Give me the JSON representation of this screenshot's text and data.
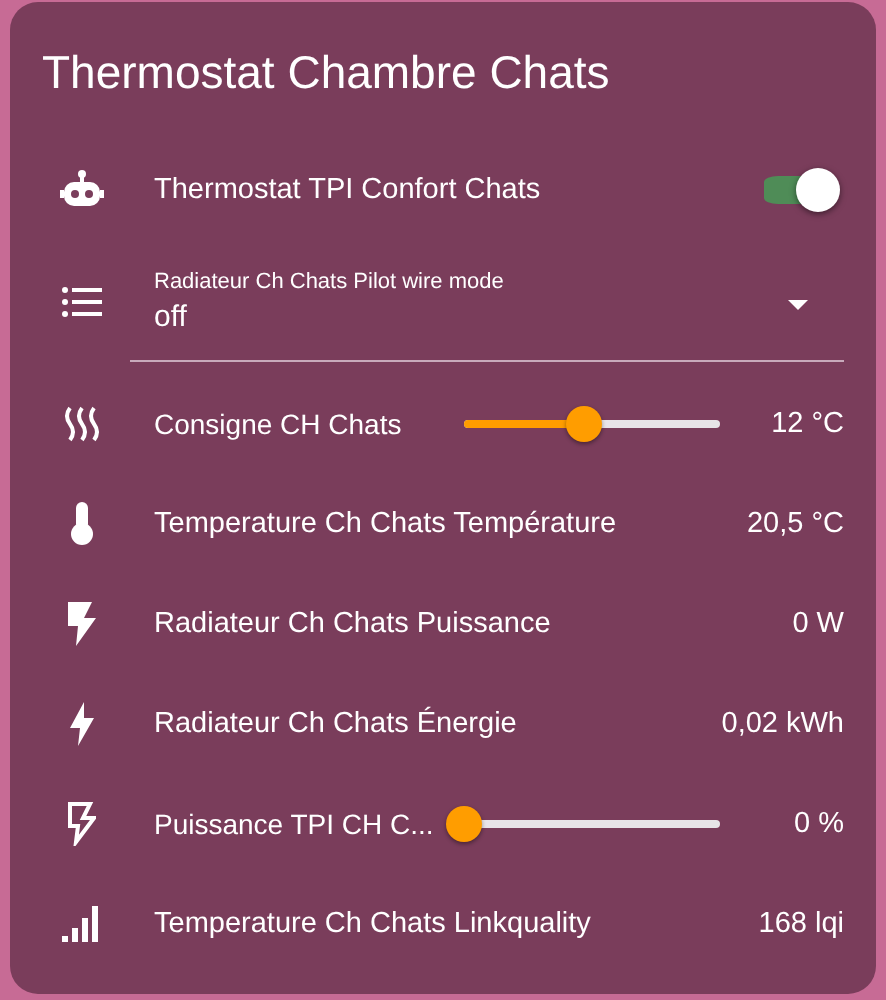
{
  "card": {
    "title": "Thermostat Chambre Chats",
    "rows": [
      {
        "kind": "toggle",
        "label": "Thermostat TPI Confort Chats",
        "on": true
      },
      {
        "kind": "select",
        "label": "Radiateur Ch Chats Pilot wire mode",
        "value": "off"
      },
      {
        "kind": "slider",
        "label": "Consigne CH Chats",
        "level": 0.47,
        "reading": "12 °C"
      },
      {
        "kind": "sensor",
        "label": "Temperature Ch Chats Température",
        "reading": "20,5 °C"
      },
      {
        "kind": "sensor",
        "label": "Radiateur Ch Chats Puissance",
        "reading": "0 W"
      },
      {
        "kind": "sensor",
        "label": "Radiateur Ch Chats Énergie",
        "reading": "0,02 kWh"
      },
      {
        "kind": "slider",
        "label": "Puissance TPI CH C...",
        "level": 0,
        "reading": "0 %"
      },
      {
        "kind": "sensor",
        "label": "Temperature Ch Chats Linkquality",
        "reading": "168 lqi"
      }
    ]
  }
}
